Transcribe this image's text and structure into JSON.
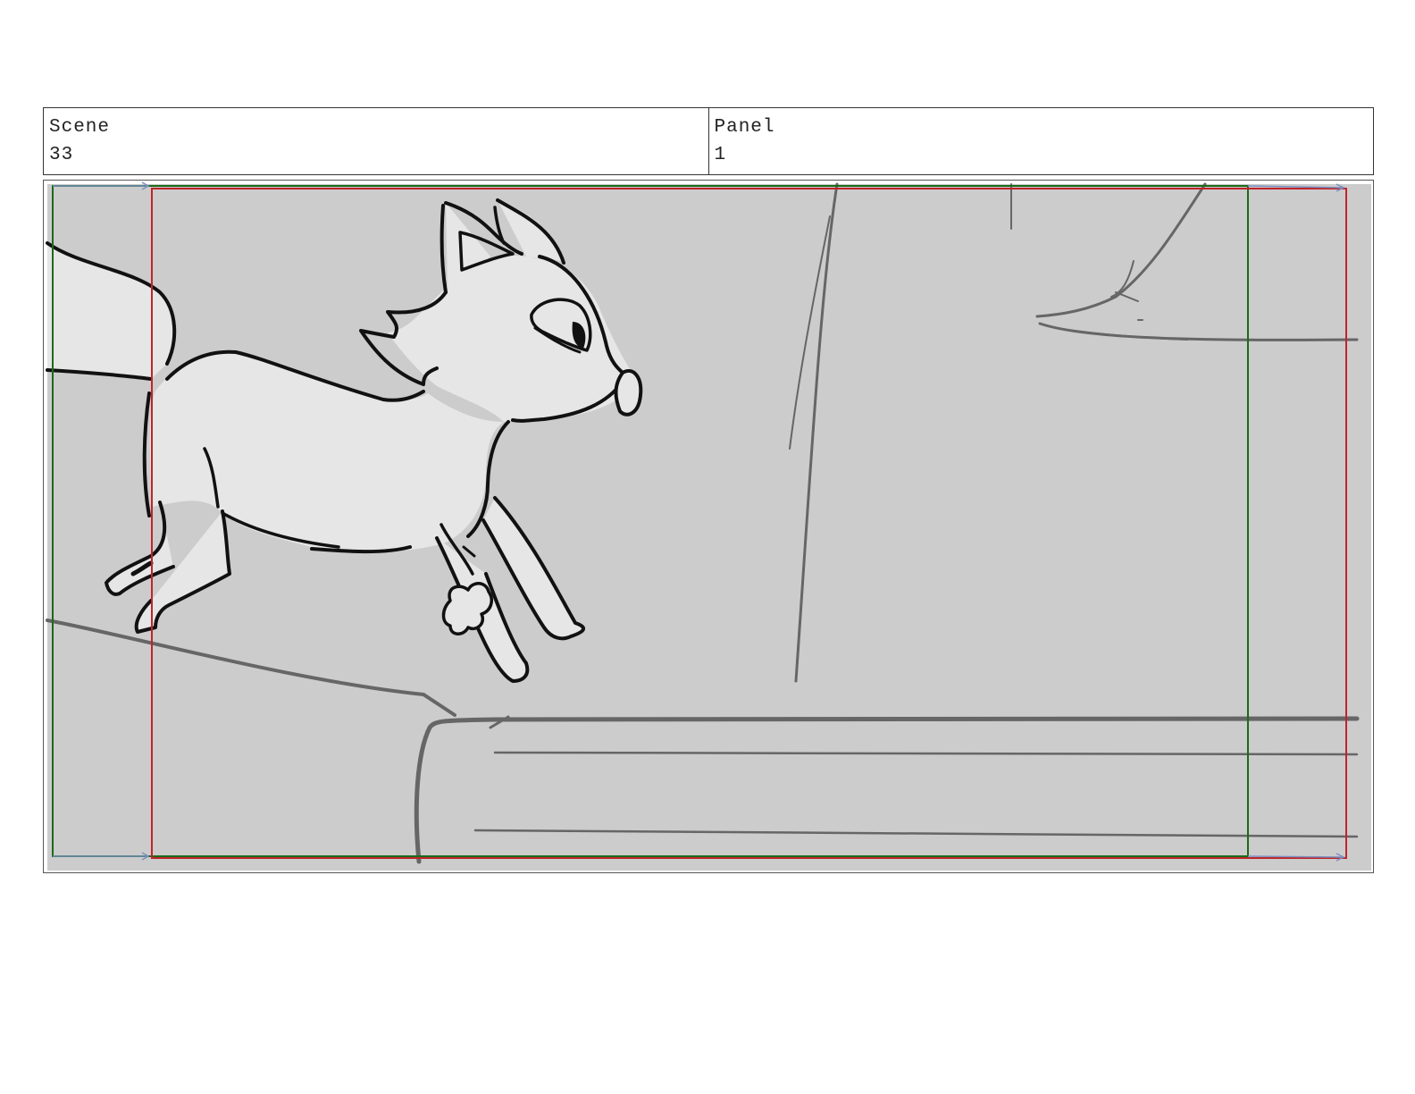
{
  "scene": {
    "label": "Scene",
    "value": "33"
  },
  "panel": {
    "label": "Panel",
    "value": "1"
  },
  "drawing": {
    "subject": "cartoon fox leaping off a rock ledge",
    "colors": {
      "background": "#cccccc",
      "fox_fill": "#e6e6e6",
      "ink": "#111111",
      "environment_line": "#666666",
      "safe_frame": "#1a6b1a",
      "camera_frame": "#c0242a"
    }
  }
}
